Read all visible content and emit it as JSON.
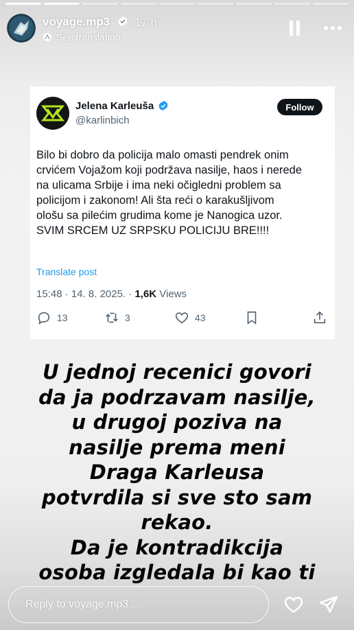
{
  "story": {
    "progress_segments": 9,
    "progress_done": 2,
    "username": "voyage.mp3",
    "time_ago": "17 h",
    "see_translation": "See translation"
  },
  "tweet": {
    "name": "Jelena Karleuša",
    "handle": "@karlinbich",
    "follow_label": "Follow",
    "text": "Bilo bi dobro da policija malo omasti pendrek onim\ncrvićem Vojažom koji podržava nasilje, haos i nerede\nna ulicama Srbije i ima neki očigledni problem sa\npolicijom i zakonom! Ali šta reći o karakušljivom\nološu sa pilećim grudima kome je Nanogica uzor.\nSVIM SRCEM UZ SRPSKU POLICIJU BRE!!!!",
    "translate_label": "Translate post",
    "meta_time": "15:48 · 14. 8. 2025. · ",
    "views_count": "1,6K",
    "views_label": " Views",
    "replies": "13",
    "retweets": "3",
    "likes": "43"
  },
  "caption": {
    "lines": [
      "U jednoj recenici govori",
      "da ja podrzavam nasilje,",
      "u drugoj poziva na",
      "nasilje prema meni",
      "Draga Karleusa",
      "potvrdila si sve sto sam",
      "rekao.",
      "Da je kontradikcija",
      "osoba izgledala bi kao ti"
    ]
  },
  "footer": {
    "reply_placeholder": "Reply to voyage.mp3..."
  },
  "colors": {
    "x_blue": "#1d9bf0",
    "insta_verified": "#3897f0",
    "follow_bg": "#0f1419",
    "logo_green": "#b5e61d"
  },
  "icons": [
    "verified-icon",
    "translate-icon",
    "pause-icon",
    "more-icon",
    "reply-icon",
    "retweet-icon",
    "like-icon",
    "bookmark-icon",
    "share-icon",
    "heart-icon",
    "send-icon"
  ]
}
